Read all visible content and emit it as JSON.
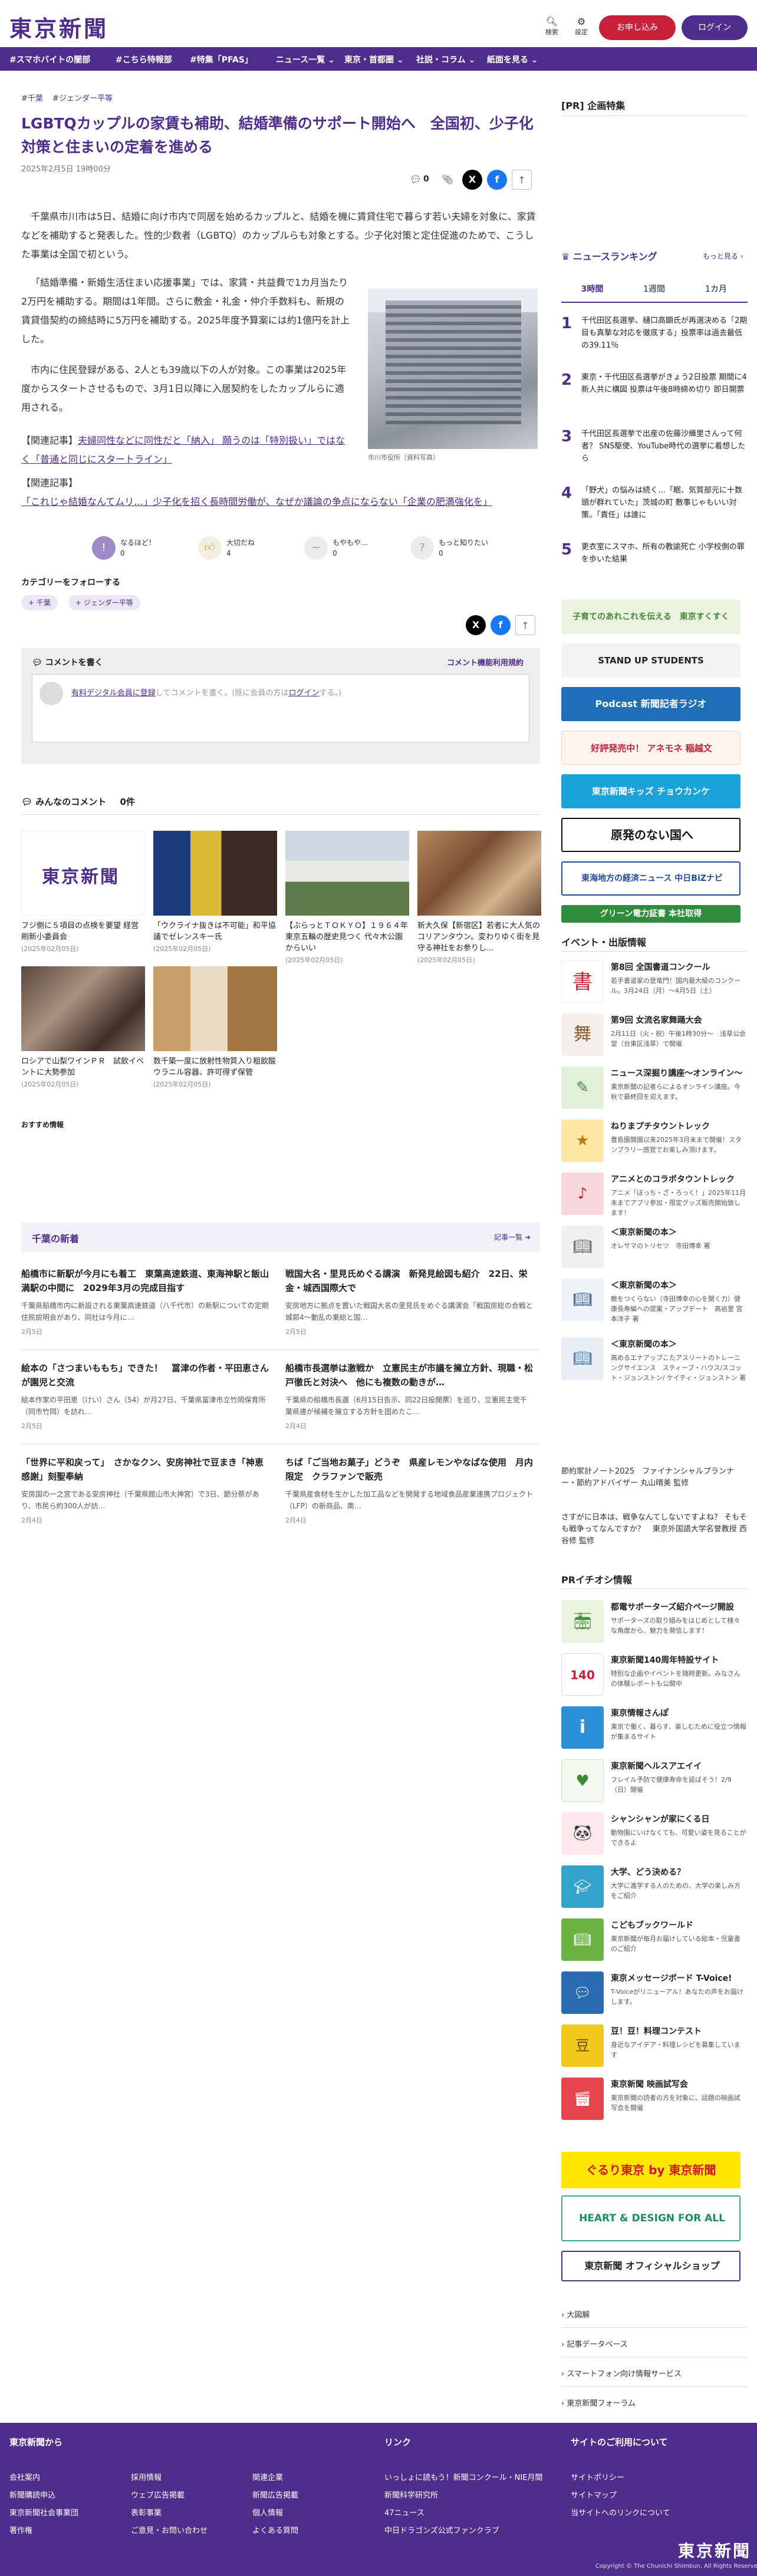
{
  "header": {
    "logo": "東京新聞",
    "search_label": "検索",
    "settings_label": "設定",
    "subscribe_label": "お申し込み",
    "login_label": "ログイン"
  },
  "nav": [
    "#スマホバイトの闇部",
    "#こちら特報部",
    "#特集「PFAS」",
    "ニュース一覧 ⌄",
    "東京・首都圏 ⌄",
    "社説・コラム ⌄",
    "紙面を見る ⌄"
  ],
  "article": {
    "breadcrumb": [
      "#千葉",
      "#ジェンダー平等"
    ],
    "title": "LGBTQカップルの家賃も補助、結婚準備のサポート開始へ　全国初、少子化対策と住まいの定着を進める",
    "date": "2025年2月5日 19時00分",
    "comment_count": "0",
    "paragraphs": [
      "千葉県市川市は5日、結婚に向け市内で同居を始めるカップルと、結婚を機に賃貸住宅で暮らす若い夫婦を対象に、家賃などを補助すると発表した。性的少数者（LGBTQ）のカップルらも対象とする。少子化対策と定住促進のためで、こうした事業は全国で初という。",
      "「結婚準備・新婚生活住まい応援事業」では、家賃・共益費で1カ月当たり2万円を補助する。期間は1年間。さらに敷金・礼金・仲介手数料も、新規の賃貸借契約の締結時に5万円を補助する。2025年度予算案には約1億円を計上した。",
      "市内に住民登録がある、2人とも39歳以下の人が対象。この事業は2025年度からスタートさせるもので、3月1日以降に入居契約をしたカップルらに適用される。"
    ],
    "photo_caption": "市川市役所（資料写真）",
    "related_prefix": "【関連記事】",
    "related": [
      "夫婦同性などに同性だと「納入」 願うのは「特別扱い」ではなく「普通と同じにスタートライン」",
      "「これじゃ結婚なんてムリ…」少子化を招く長時間労働が、なぜか議論の争点にならない「企業の肥満強化を」"
    ],
    "reactions": [
      {
        "label": "なるほど！",
        "count": "0"
      },
      {
        "label": "大切だね",
        "count": "4"
      },
      {
        "label": "もやもや…",
        "count": "0"
      },
      {
        "label": "もっと知りたい",
        "count": "0"
      }
    ],
    "follow_title": "カテゴリーをフォローする",
    "follow_tags": [
      "+ 千葉",
      "+ ジェンダー平等"
    ]
  },
  "comment_box": {
    "title": "コメントを書く",
    "rules": "コメント機能利用規約",
    "placeholder_prefix": "有料デジタル会員に登録",
    "placeholder_mid": "してコメントを書く。(既に会員の方は",
    "placeholder_login": "ログイン",
    "placeholder_suffix": "する。)"
  },
  "comments": {
    "title": "みんなのコメント",
    "count": "0件"
  },
  "recommended": [
    {
      "title": "フジ側に５項目の点検を要望 経営刷新小委員会",
      "date": "(2025年02月05日)"
    },
    {
      "title": "「ウクライナ抜きは不可能」和平協議でゼレンスキー氏",
      "date": "(2025年02月05日)"
    },
    {
      "title": "【ぶらっとＴＯＫＹＯ】１９６４年東京五輪の歴史見つく 代々木公園からいい",
      "date": "(2025年02月05日)"
    },
    {
      "title": "新大久保【新宿区】若者に大人気のコリアンタウン。変わりゆく街を見守る神社をお参りし…",
      "date": "(2025年02月05日)"
    },
    {
      "title": "ロシアで山梨ワインＰＲ　試飲イベントに大勢参加",
      "date": "(2025年02月05日)"
    },
    {
      "title": "数千築一度に放射性物質入り粗飲酸ウラニル容器、許可得ず保管",
      "date": "(2025年02月05日)"
    }
  ],
  "recommended_label": "おすすめ情報",
  "latest": {
    "title": "千葉の新着",
    "more": "記事一覧 ➔",
    "items": [
      {
        "title": "船橋市に新駅が今月にも着工　東葉高速鉄道、東海神駅と飯山満駅の中間に　2029年3月の完成目指す",
        "summary": "千葉県船橋市内に新設される東葉高速鉄道（八千代市）の新駅についての定期住民説明会があり、同社は今月に…",
        "date": "2月5日"
      },
      {
        "title": "戦国大名・里見氏めぐる講演　新発見絵図も紹介　22日、栄金・城西国際大で",
        "summary": "安房地方に拠点を置いた戦国大名の里見氏をめぐる講演会「戦国房総の合戦と城郭4～動乱の東総と国…",
        "date": "2月5日"
      },
      {
        "title": "絵本の「さつまいももち」できた！　冨津の作者・平田恵さんが園児と交流",
        "summary": "絵本作家の平田恵（けい）さん（54）が月27日、千葉県富津市立竹岡保育所（同市竹岡）を訪れ…",
        "date": "2月5日"
      },
      {
        "title": "船橋市長選挙は激戦か　立憲民主が市議を擁立方針、現職・松戸徹氏と対決へ　他にも複数の動きが…",
        "summary": "千葉県の船橋市長選（6月15日告示、同22日投開票）を巡り、立憲民主党千葉県連が候補を擁立する方針を固めたこ…",
        "date": "2月4日"
      },
      {
        "title": "「世界に平和戻って」　さかなクン、安房神社で豆まき「神恵感謝」刻聖奉納",
        "summary": "安房国の一之宮である安房神社（千葉県館山市大神宮）で3日、節分祭があり、市民ら約300人が訪…",
        "date": "2月4日"
      },
      {
        "title": "ちば「ご当地お菓子」どうぞ　県産レモンやなばな使用　月内限定　クラファンで販売",
        "summary": "千葉県産食材を生かした加工品などを開発する地域食品産業連携プロジェクト（LFP）の新商品、南…",
        "date": "2月4日"
      }
    ]
  },
  "sidebar": {
    "pr_title": "[PR] 企画特集",
    "ranking_title": "ニュースランキング",
    "ranking_more": "もっと見る ›",
    "ranking_tabs": [
      "3時間",
      "1週間",
      "1カ月"
    ],
    "ranking": [
      {
        "n": "1",
        "title": "千代田区長選挙、樋口高顕氏が再選決める「2期目も真摯な対応を徹底する」投票率は過去最低の39.11％"
      },
      {
        "n": "2",
        "title": "東京・千代田区長選挙がきょう2日投票 期間に4新人共に構図 投票は午後8時締め切り 即日開票"
      },
      {
        "n": "3",
        "title": "千代田区長選挙で出産の佐藤沙織里さんって何者？ SNS駆使、YouTube時代の選挙に着想したら"
      },
      {
        "n": "4",
        "title": "「野犬」の悩みは続く…「眠、気質部元に十数頭が群れていた」茨城の町 敷事じゃもいい対策。「責任」は誰に"
      },
      {
        "n": "5",
        "title": "更衣室にスマホ、所有の教諭死亡 小学校側の罪を歩いた結果"
      }
    ],
    "banners": [
      "子育てのあれこれを伝える　東京すくすく",
      "STAND UP STUDENTS",
      "Podcast 新聞記者ラジオ",
      "好評発売中！ アネモネ 稲越文",
      "東京新聞キッズ チョウカンケ",
      "原発のない国へ",
      "東海地方の経済ニュース 中日BiZナビ",
      "グリーン電力証書 本社取得"
    ],
    "events_title": "イベント・出版情報",
    "events": [
      {
        "title": "第8回 全国書道コンクール",
        "sub": "若手書道家の登竜門！国内最大級のコンクール。3月24日（月）～4月5日（土）"
      },
      {
        "title": "第9回 女流名家舞踊大会",
        "sub": "2月11日（火・祝）午後1時30分～　浅草公会堂（台東区浅草）で開催"
      },
      {
        "title": "ニュース深掘り講座～オンライン～",
        "sub": "東京新聞の記者らによるオンライン講座。今秋で最終回を迎えます。"
      },
      {
        "title": "ねりまプチタウントレック",
        "sub": "豊島園開園以来2025年3月末まで開催！スタンプラリー感覚でお楽しみ頂けます。"
      },
      {
        "title": "アニメとのコラボタウントレック",
        "sub": "アニメ「ぼっち・ざ・ろっく！」2025年11月末までアプリ参加・限定グッズ販売開始致します！"
      },
      {
        "title": "＜東京新聞の本＞",
        "sub": "オレサマのトリセツ　寺田博幸 著"
      },
      {
        "title": "＜東京新聞の本＞",
        "sub": "敵をつくらない（寺田博幸の心を開く力）健康長寿編への提案・アップデート　高岩里 宮本洋子 著"
      },
      {
        "title": "＜東京新聞の本＞",
        "sub": "高めるエナアップこたアスリートのトレーニングサイエンス　スティーブ・ハウス/スコット・ジョンストン/ ケイティ・ジョンストン 著"
      }
    ],
    "links1": [
      "節約家計ノート2025　ファイナンシャルプランナー・節約アドバイザー 丸山晴美 監修",
      "さすがに日本は、戦争なんてしないですよね？ そもそも戦争ってなんですか？　東京外国語大学名誉教授 西谷修 監修"
    ],
    "pr_event_title": "PRイチオシ情報",
    "pr_events": [
      {
        "title": "都電サポーターズ紹介ページ開設",
        "sub": "サポーターズの取り組みをはじめとして様々な角度から、魅力を発信します！"
      },
      {
        "title": "東京新聞140周年特設サイト",
        "sub": "特別な企画やイベントを随時更新。みなさんの体験レポートも公開中"
      },
      {
        "title": "東京情報さんぽ",
        "sub": "東京で働く、暮らす、楽しむために役立つ情報が集まるサイト"
      },
      {
        "title": "東京新聞ヘルスアエイイ",
        "sub": "フレイル予防で健康寿命を延ばそう！2/9（日）開催"
      },
      {
        "title": "シャンシャンが家にくる日",
        "sub": "動物園にいけなくても、可愛い姿を見ることができるよ"
      },
      {
        "title": "大学、どう決める？",
        "sub": "大学に進学する人のための、大学の楽しみ方をご紹介"
      },
      {
        "title": "こどもブックワールド",
        "sub": "東京新聞が毎月お届けしている絵本・児童書のご紹介"
      },
      {
        "title": "東京メッセージボード T-Voice!",
        "sub": "T-Voiceがリニューアル！あなたの声をお届けします。"
      },
      {
        "title": "豆！豆！料理コンテスト",
        "sub": "身近なアイデア・料理レシピを募集しています"
      },
      {
        "title": "東京新聞 映画試写会",
        "sub": "東京新聞の読者の方を対象に、話題の映画試写会を開催"
      }
    ],
    "bottom_banners": [
      "ぐるり東京 by 東京新聞",
      "HEART & DESIGN FOR ALL",
      "東京新聞 オフィシャルショップ"
    ],
    "bottom_links": [
      "› 大図解",
      "› 記事データベース",
      "› スマートフォン向け情報サービス",
      "› 東京新聞フォーラム"
    ]
  },
  "footer": {
    "col1_title": "東京新聞から",
    "col1": [
      "会社案内",
      "新聞購読申込",
      "東京新聞社会事業団",
      "著作権",
      "採用情報",
      "ウェブ広告掲載",
      "表彰事業",
      "ご意見・お問い合わせ",
      "関連企業",
      "新聞広告掲載",
      "個人情報",
      "よくある質問"
    ],
    "col2_title": "リンク",
    "col2": [
      "いっしょに読もう！新聞コンクール・NIE月間",
      "新聞科学研究所",
      "47ニュース",
      "中日ドラゴンズ公式ファンクラブ"
    ],
    "col3_title": "サイトのご利用について",
    "col3": [
      "サイトポリシー",
      "サイトマップ",
      "当サイトへのリンクについて"
    ],
    "logo": "東京新聞",
    "copyright": "Copyright © The Chunichi Shimbun, All Rights Reserved."
  }
}
